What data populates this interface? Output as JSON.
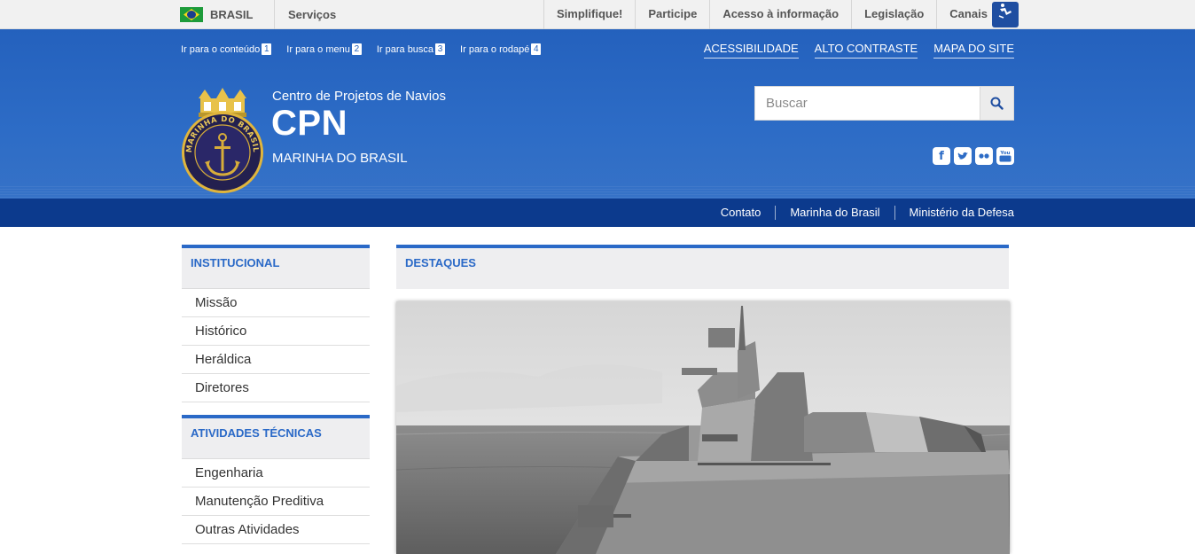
{
  "govbar": {
    "country": "BRASIL",
    "services": "Serviços",
    "links": [
      "Simplifique!",
      "Participe",
      "Acesso à informação",
      "Legislação",
      "Canais"
    ]
  },
  "header": {
    "skip_links": [
      {
        "label": "Ir para o conteúdo",
        "key": "1"
      },
      {
        "label": "Ir para o menu",
        "key": "2"
      },
      {
        "label": "Ir para busca",
        "key": "3"
      },
      {
        "label": "Ir para o rodapé",
        "key": "4"
      }
    ],
    "top_links": [
      "ACESSIBILIDADE",
      "ALTO CONTRASTE",
      "MAPA DO SITE"
    ],
    "subtitle": "Centro de Projetos de Navios",
    "title": "CPN",
    "org": "MARINHA DO BRASIL",
    "logo_text": "MARINHA DO BRASIL",
    "search_placeholder": "Buscar",
    "social": [
      "facebook-icon",
      "twitter-icon",
      "flickr-icon",
      "youtube-icon"
    ]
  },
  "subnav": {
    "links": [
      "Contato",
      "Marinha do Brasil",
      "Ministério da Defesa"
    ]
  },
  "sidebar": {
    "sections": [
      {
        "title": "INSTITUCIONAL",
        "items": [
          "Missão",
          "Histórico",
          "Heráldica",
          "Diretores"
        ]
      },
      {
        "title": "ATIVIDADES TÉCNICAS",
        "items": [
          "Engenharia",
          "Manutenção Preditiva",
          "Outras Atividades"
        ]
      }
    ]
  },
  "main": {
    "destaques_title": "DESTAQUES"
  },
  "colors": {
    "header_blue": "#2461bd",
    "nav_dark_blue": "#0c3a8d",
    "accent_blue": "#2a69c7"
  }
}
